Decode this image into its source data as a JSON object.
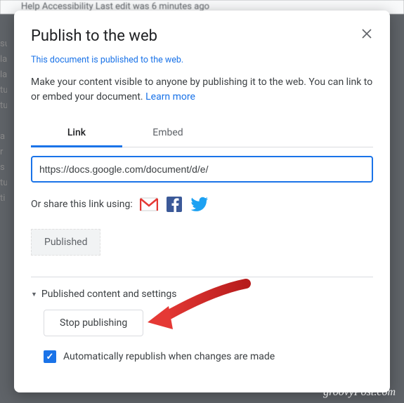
{
  "bg": {
    "toolbar": "Help   Accessibility     Last edit was 6 minutes ago"
  },
  "modal": {
    "title": "Publish to the web",
    "notice": "This document is published to the web.",
    "description_pre": "Make your content visible to anyone by publishing it to the web. You can link to or embed your document. ",
    "learn_more": "Learn more",
    "tabs": {
      "link": "Link",
      "embed": "Embed"
    },
    "url_value": "https://docs.google.com/document/d/e/",
    "share_label": "Or share this link using:",
    "published_badge": "Published",
    "expander_label": "Published content and settings",
    "stop_button": "Stop publishing",
    "auto_republish_label": "Automatically republish when changes are made",
    "auto_republish_checked": true
  },
  "icons": {
    "gmail": "gmail-icon",
    "facebook": "facebook-icon",
    "twitter": "twitter-icon",
    "close": "close-icon",
    "caret": "caret-down-icon",
    "check": "check-icon"
  },
  "watermark": "groovyPost.com"
}
